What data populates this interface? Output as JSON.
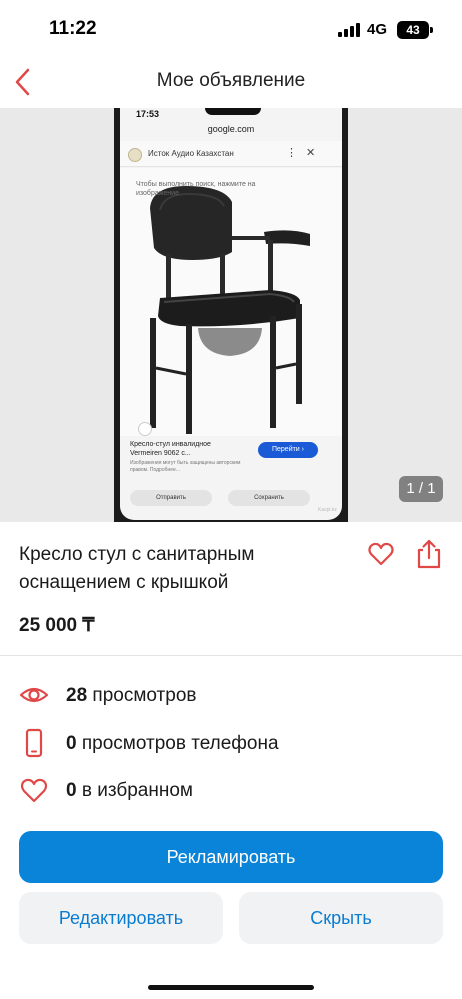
{
  "status_bar": {
    "time": "11:22",
    "network": "4G",
    "battery": "43"
  },
  "header": {
    "title": "Мое объявление",
    "back_icon": "chevron-left-icon"
  },
  "photo": {
    "counter": "1 / 1",
    "phone_screen": {
      "time": "17:53",
      "url": "google.com",
      "site_name": "Исток Аудио Казахстан",
      "hint": "Чтобы выполнить поиск, нажмите на изображение",
      "result_title": "Кресло-стул инвалидное Vermeiren 9062 с...",
      "result_button": "Перейти ›",
      "result_note": "Изображения могут быть защищены авторским правом. Подробнее...",
      "action_send": "Отправить",
      "action_save": "Сохранить",
      "watermark": "Kaspi.kz"
    }
  },
  "listing": {
    "title": "Кресло стул с санитарным оснащением с крышкой",
    "price": "25 000 ₸"
  },
  "stats": {
    "views_count": "28",
    "views_label": "просмотров",
    "phone_count": "0",
    "phone_label": "просмотров телефона",
    "fav_count": "0",
    "fav_label": "в избранном"
  },
  "buttons": {
    "promote": "Рекламировать",
    "edit": "Редактировать",
    "hide": "Скрыть"
  },
  "colors": {
    "accent_red": "#e04848",
    "primary_blue": "#0a84d8",
    "link_blue": "#0a7cd0"
  }
}
